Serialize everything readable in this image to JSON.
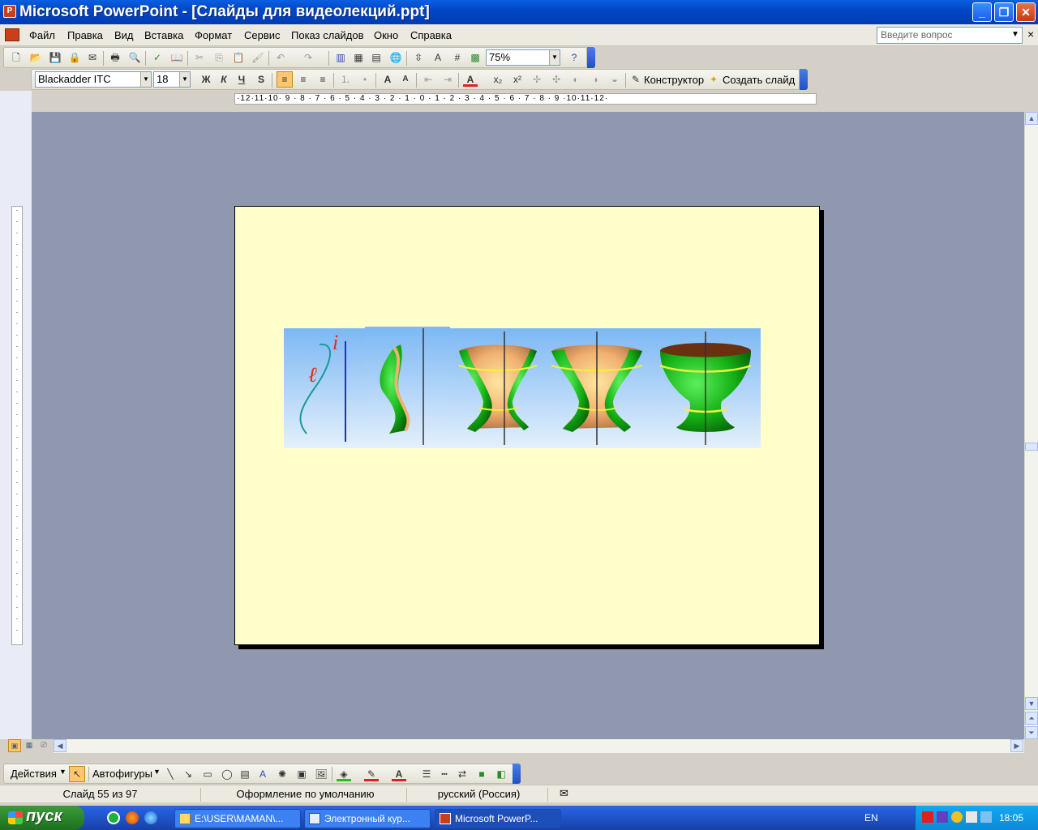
{
  "window": {
    "title": "Microsoft PowerPoint - [Слайды для видеолекций.ppt]",
    "app_icon": "powerpoint-icon",
    "minimize": "_",
    "maximize": "❐",
    "close": "✕"
  },
  "menu": {
    "items": [
      "Файл",
      "Правка",
      "Вид",
      "Вставка",
      "Формат",
      "Сервис",
      "Показ слайдов",
      "Окно",
      "Справка"
    ],
    "help_placeholder": "Введите вопрос",
    "doc_close": "×"
  },
  "standard_toolbar": {
    "zoom": "75%"
  },
  "format_toolbar": {
    "font": "Blackadder ITC",
    "font_size": "18",
    "bold": "Ж",
    "italic": "К",
    "underline": "Ч",
    "shadow": "S",
    "designer": "Конструктор",
    "new_slide": "Создать слайд"
  },
  "ruler": {
    "horizontal": "·12·11·10· 9 · 8 · 7 · 6 · 5 · 4 · 3 · 2 · 1 · 0 · 1 · 2 · 3 · 4 · 5 · 6 · 7 · 8 · 9 ·10·11·12·"
  },
  "slide": {
    "labels": {
      "curve": "ℓ",
      "axis": "i"
    },
    "colors": {
      "background": "#ffffcc",
      "surface_green": "#12b012",
      "inner_orange": "#f0b070",
      "axis_blue": "#2030c0",
      "curve_teal": "#1a9a9a"
    }
  },
  "draw_toolbar": {
    "actions": "Действия",
    "autoshapes": "Автофигуры"
  },
  "status": {
    "slide": "Слайд 55 из 97",
    "design": "Оформление по умолчанию",
    "language": "русский (Россия)"
  },
  "taskbar": {
    "start": "пуск",
    "tasks": [
      "E:\\USER\\MAMAN\\...",
      "Электронный кур...",
      "Microsoft PowerP..."
    ],
    "lang": "EN",
    "clock": "18:05"
  }
}
